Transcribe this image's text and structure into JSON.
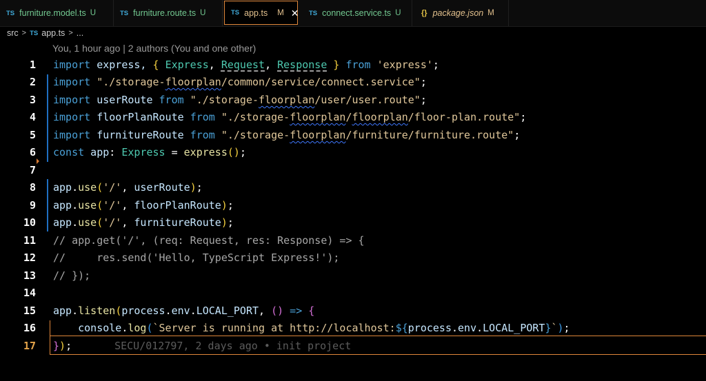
{
  "tabs": [
    {
      "icon": "TS",
      "name": "furniture.model.ts",
      "status": "U"
    },
    {
      "icon": "TS",
      "name": "furniture.route.ts",
      "status": "U"
    },
    {
      "icon": "TS",
      "name": "app.ts",
      "status": "M"
    },
    {
      "icon": "TS",
      "name": "connect.service.ts",
      "status": "U"
    },
    {
      "icon": "{}",
      "name": "package.json",
      "status": "M"
    }
  ],
  "close_glyph": "✕",
  "breadcrumb": {
    "folder": "src",
    "sep": ">",
    "file_icon": "TS",
    "file": "app.ts",
    "more": "..."
  },
  "codelens": "You, 1 hour ago | 2 authors (You and one other)",
  "line_numbers": [
    "1",
    "2",
    "3",
    "4",
    "5",
    "6",
    "7",
    "8",
    "9",
    "10",
    "11",
    "12",
    "13",
    "14",
    "15",
    "16",
    "17"
  ],
  "code": {
    "l1": {
      "kw": "import",
      "t1": " express, ",
      "ob": "{",
      "t2": " ",
      "ty1": "Express",
      "c1": ", ",
      "ty2": "Request",
      "c2": ", ",
      "ty3": "Response",
      "t3": " ",
      "cb": "}",
      "t4": " ",
      "from": "from",
      "t5": " ",
      "str": "'express'",
      "semi": ";"
    },
    "l2": {
      "kw": "import",
      "sp": " ",
      "s1": "\"./storage-",
      "sq": "floorplan",
      "s2": "/common/service/connect.service\"",
      "semi": ";"
    },
    "l3": {
      "kw": "import",
      "id": " userRoute ",
      "from": "from",
      "sp": " ",
      "s1": "\"./storage-",
      "sq": "floorplan",
      "s2": "/user/user.route\"",
      "semi": ";"
    },
    "l4": {
      "kw": "import",
      "id": " floorPlanRoute ",
      "from": "from",
      "sp": " ",
      "s1": "\"./storage-",
      "sq": "floorplan",
      "s2": "/",
      "sq2": "floorplan",
      "s3": "/floor-plan.route\"",
      "semi": ";"
    },
    "l5": {
      "kw": "import",
      "id": " furnitureRoute ",
      "from": "from",
      "sp": " ",
      "s1": "\"./storage-",
      "sq": "floorplan",
      "s2": "/furniture/furniture.route\"",
      "semi": ";"
    },
    "l6": {
      "kw": "const",
      "id": " app",
      "colon": ": ",
      "ty": "Express",
      "eq": " = ",
      "fn": "express",
      "paren": "()",
      "semi": ";"
    },
    "l8": {
      "obj": "app",
      "dot": ".",
      "fn": "use",
      "op": "(",
      "str": "'/'",
      "c": ", ",
      "arg": "userRoute",
      "cp": ")",
      "semi": ";"
    },
    "l9": {
      "obj": "app",
      "dot": ".",
      "fn": "use",
      "op": "(",
      "str": "'/'",
      "c": ", ",
      "arg": "floorPlanRoute",
      "cp": ")",
      "semi": ";"
    },
    "l10": {
      "obj": "app",
      "dot": ".",
      "fn": "use",
      "op": "(",
      "str": "'/'",
      "c": ", ",
      "arg": "furnitureRoute",
      "cp": ")",
      "semi": ";"
    },
    "l11": "// app.get('/', (req: Request, res: Response) => {",
    "l12": "//     res.send('Hello, TypeScript Express!');",
    "l13": "// });",
    "l15": {
      "obj": "app",
      "dot": ".",
      "fn": "listen",
      "op": "(",
      "a1": "process",
      "d1": ".",
      "a2": "env",
      "d2": ".",
      "a3": "LOCAL_PORT",
      "c": ", ",
      "p2": "()",
      "arrow": " => ",
      "ob": "{"
    },
    "l16": {
      "indent": "    ",
      "obj": "console",
      "dot": ".",
      "fn": "log",
      "op": "(",
      "s1": "`Server is running at http://localhost:",
      "ds": "${",
      "a1": "process",
      "d1": ".",
      "a2": "env",
      "d2": ".",
      "a3": "LOCAL_PORT",
      "de": "}",
      "s2": "`",
      "cp": ")",
      "semi": ";"
    },
    "l17": {
      "cb": "}",
      "cp": ")",
      "semi": ";"
    }
  },
  "blame_inline": "SECU/012797, 2 days ago • init project"
}
